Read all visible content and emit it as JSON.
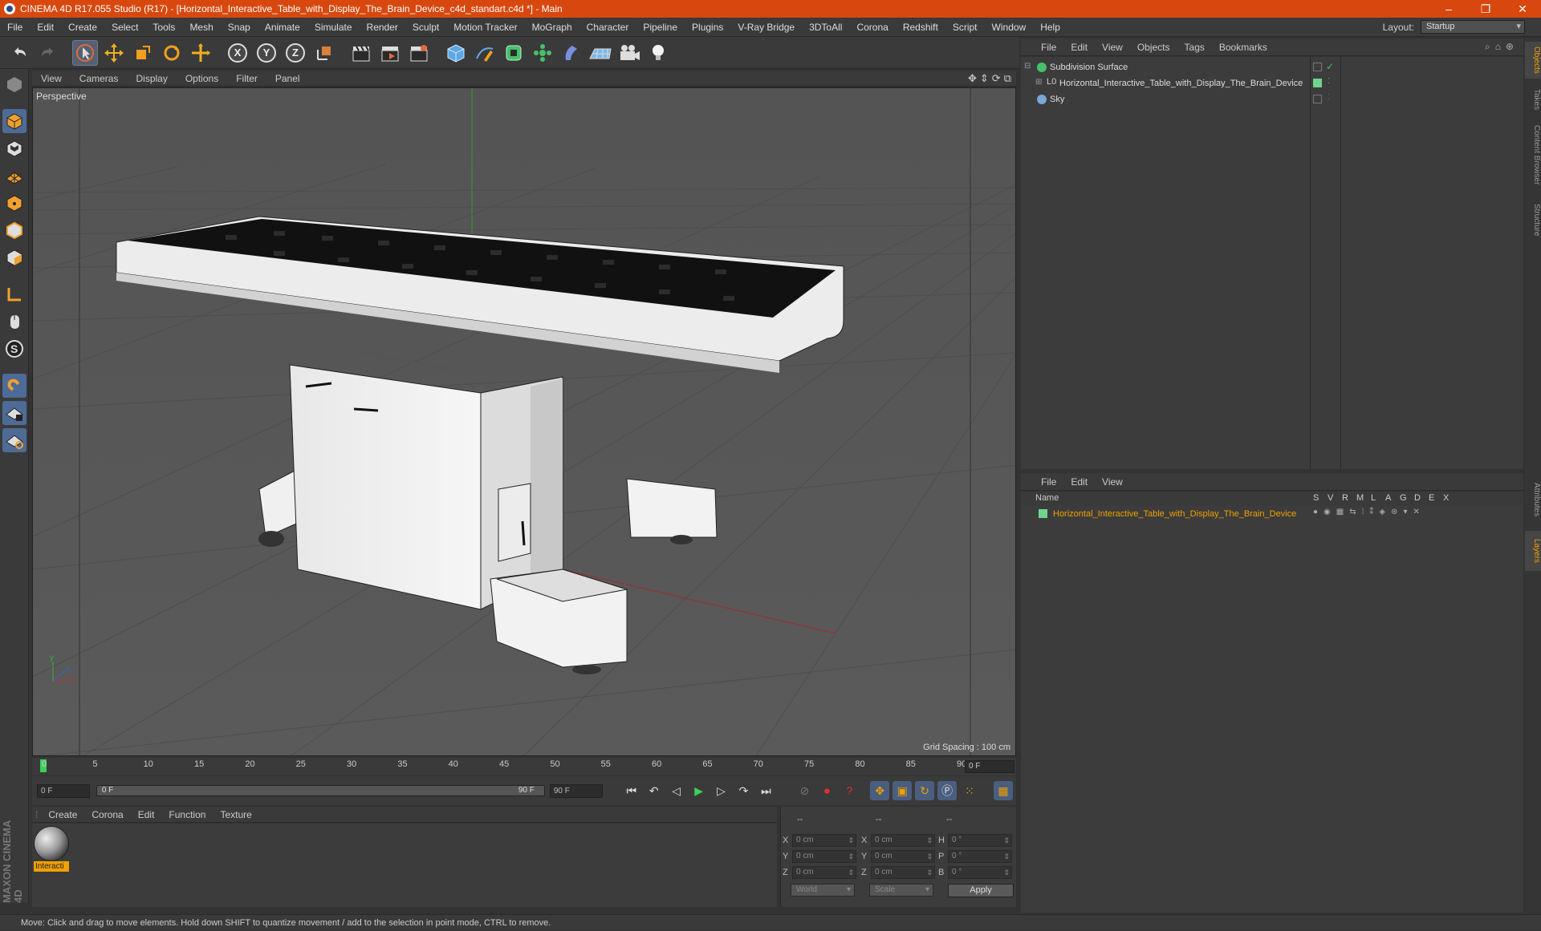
{
  "window": {
    "title": "CINEMA 4D R17.055 Studio (R17) - [Horizontal_Interactive_Table_with_Display_The_Brain_Device_c4d_standart.c4d *] - Main",
    "minimize": "–",
    "restore": "❐",
    "close": "✕"
  },
  "menu": [
    "File",
    "Edit",
    "Create",
    "Select",
    "Tools",
    "Mesh",
    "Snap",
    "Animate",
    "Simulate",
    "Render",
    "Sculpt",
    "Motion Tracker",
    "MoGraph",
    "Character",
    "Pipeline",
    "Plugins",
    "V-Ray Bridge",
    "3DToAll",
    "Corona",
    "Redshift",
    "Script",
    "Window",
    "Help"
  ],
  "layout": {
    "label": "Layout:",
    "value": "Startup"
  },
  "toolbar": {
    "axis_x": "X",
    "axis_y": "Y",
    "axis_z": "Z"
  },
  "viewport": {
    "menu": [
      "View",
      "Cameras",
      "Display",
      "Options",
      "Filter",
      "Panel"
    ],
    "label": "Perspective",
    "grid_spacing": "Grid Spacing : 100 cm",
    "axis_y": "y",
    "axis_z": "z",
    "axis_x": "x"
  },
  "timeline": {
    "ticks": [
      "0",
      "5",
      "10",
      "15",
      "20",
      "25",
      "30",
      "35",
      "40",
      "45",
      "50",
      "55",
      "60",
      "65",
      "70",
      "75",
      "80",
      "85",
      "90"
    ],
    "current_frame": "0 F",
    "start_field": "0 F",
    "range_start": "0 F",
    "range_end": "90 F",
    "end_field": "90 F"
  },
  "material_manager": {
    "menu": [
      "Create",
      "Corona",
      "Edit",
      "Function",
      "Texture"
    ],
    "materials": [
      {
        "label": "Interacti"
      }
    ]
  },
  "coordinates": {
    "header": [
      "--",
      "--",
      "--"
    ],
    "rows": [
      {
        "pos_label": "X",
        "pos": "0 cm",
        "size_label": "X",
        "size": "0 cm",
        "rot_label": "H",
        "rot": "0 °"
      },
      {
        "pos_label": "Y",
        "pos": "0 cm",
        "size_label": "Y",
        "size": "0 cm",
        "rot_label": "P",
        "rot": "0 °"
      },
      {
        "pos_label": "Z",
        "pos": "0 cm",
        "size_label": "Z",
        "size": "0 cm",
        "rot_label": "B",
        "rot": "0 °"
      }
    ],
    "mode_world": "World",
    "mode_scale": "Scale",
    "apply": "Apply"
  },
  "object_manager": {
    "menu": [
      "File",
      "Edit",
      "View",
      "Objects",
      "Tags",
      "Bookmarks"
    ],
    "objects": [
      {
        "name": "Subdivision Surface",
        "icon_color": "#46c06a"
      },
      {
        "name": "Horizontal_Interactive_Table_with_Display_The_Brain_Device",
        "icon_color": "#c9c9c9"
      },
      {
        "name": "Sky",
        "icon_color": "#7aa6d8"
      }
    ]
  },
  "layer_manager": {
    "menu": [
      "File",
      "Edit",
      "View"
    ],
    "columns": [
      "Name",
      "S",
      "V",
      "R",
      "M",
      "L",
      "A",
      "G",
      "D",
      "E",
      "X"
    ],
    "layers": [
      {
        "name": "Horizontal_Interactive_Table_with_Display_The_Brain_Device",
        "color": "#6fd48c"
      }
    ]
  },
  "right_tabs": [
    "Objects",
    "Takes",
    "Content Browser",
    "Structure",
    "Attributes",
    "Layers"
  ],
  "status": "Move: Click and drag to move elements. Hold down SHIFT to quantize movement / add to the selection in point mode, CTRL to remove.",
  "brand": {
    "logo": "MAXON CINEMA 4D"
  },
  "colors": {
    "titlebar": "#d8480e",
    "accent_orange": "#f0a000",
    "layer_text": "#f0a000",
    "playhead": "#3cd05a"
  }
}
